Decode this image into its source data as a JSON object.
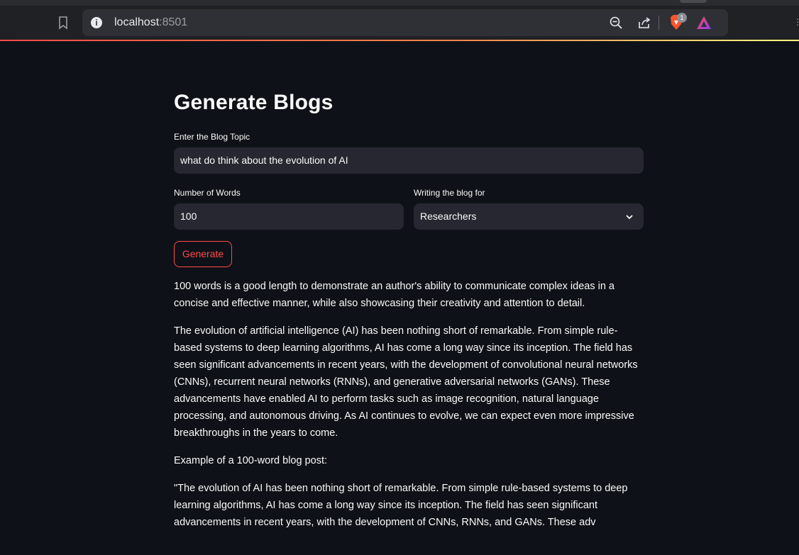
{
  "browser": {
    "url_host": "localhost",
    "url_port": ":8501",
    "brave_badge_count": "1"
  },
  "app": {
    "title": "Generate Blogs",
    "topic_label": "Enter the Blog Topic",
    "topic_value": "what do think about the evolution of AI",
    "words_label": "Number of Words",
    "words_value": "100",
    "audience_label": "Writing the blog for",
    "audience_value": "Researchers",
    "generate_label": "Generate"
  },
  "output": {
    "p1": "100 words is a good length to demonstrate an author's ability to communicate complex ideas in a concise and effective manner, while also showcasing their creativity and attention to detail.",
    "p2": "The evolution of artificial intelligence (AI) has been nothing short of remarkable. From simple rule-based systems to deep learning algorithms, AI has come a long way since its inception. The field has seen significant advancements in recent years, with the development of convolutional neural networks (CNNs), recurrent neural networks (RNNs), and generative adversarial networks (GANs). These advancements have enabled AI to perform tasks such as image recognition, natural language processing, and autonomous driving. As AI continues to evolve, we can expect even more impressive breakthroughs in the years to come.",
    "p3": "Example of a 100-word blog post:",
    "p4": "\"The evolution of AI has been nothing short of remarkable. From simple rule-based systems to deep learning algorithms, AI has come a long way since its inception. The field has seen significant advancements in recent years, with the development of CNNs, RNNs, and GANs. These adv"
  },
  "colors": {
    "page_bg": "#0e1117",
    "input_bg": "#262730",
    "accent": "#ff4b4b"
  }
}
